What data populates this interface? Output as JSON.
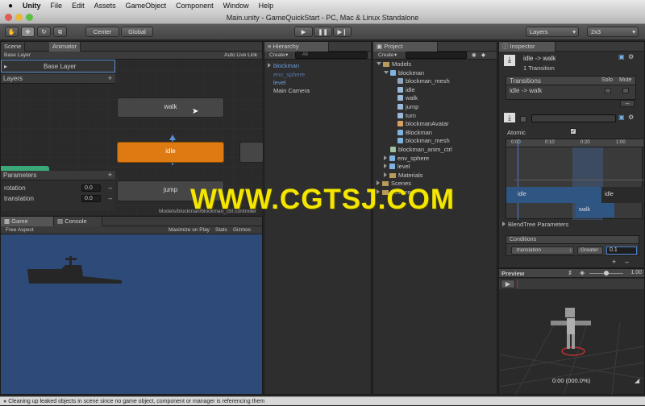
{
  "menubar": {
    "app": "Unity",
    "items": [
      "File",
      "Edit",
      "Assets",
      "GameObject",
      "Component",
      "Window",
      "Help"
    ]
  },
  "window": {
    "title": "Main.unity - GameQuickStart - PC, Mac & Linux Standalone"
  },
  "toolbar": {
    "center": "Center",
    "global": "Global",
    "layers": "Layers",
    "layout": "2x3"
  },
  "animator": {
    "tabs": [
      "Scene",
      "Animator"
    ],
    "base_layer_crumb": "Base Layer",
    "auto_live_link": "Auto Live Link",
    "layer_name": "Base Layer",
    "layers_label": "Layers",
    "add": "+",
    "parameters_label": "Parameters",
    "params": [
      {
        "name": "rotation",
        "value": "0.0"
      },
      {
        "name": "translation",
        "value": "0.0"
      }
    ],
    "nodes": {
      "walk": "walk",
      "idle": "idle",
      "jump": "jump"
    },
    "footer": "Models/blockman/blockman_ctrl.controller"
  },
  "game": {
    "tabs": [
      "Game",
      "Console"
    ],
    "aspect": "Free Aspect",
    "maximize": "Maximize on Play",
    "stats": "Stats",
    "gizmos": "Gizmos"
  },
  "hierarchy": {
    "tab": "Hierarchy",
    "create": "Create",
    "search": "All",
    "items": [
      {
        "label": "blockman",
        "color": "#6a9fe0"
      },
      {
        "label": "env_sphere",
        "color": "#5577aa"
      },
      {
        "label": "level",
        "color": "#6a9fe0"
      },
      {
        "label": "Main Camera",
        "color": "#c8c8c8"
      }
    ]
  },
  "project": {
    "tab": "Project",
    "create": "Create",
    "items": [
      {
        "label": "Models",
        "indent": 0,
        "kind": "folder",
        "exp": "open"
      },
      {
        "label": "blockman",
        "indent": 1,
        "kind": "model",
        "exp": "open"
      },
      {
        "label": "blockman_mesh",
        "indent": 2,
        "kind": "mesh",
        "exp": ""
      },
      {
        "label": "idle",
        "indent": 2,
        "kind": "anim",
        "exp": ""
      },
      {
        "label": "walk",
        "indent": 2,
        "kind": "anim",
        "exp": ""
      },
      {
        "label": "jump",
        "indent": 2,
        "kind": "anim",
        "exp": ""
      },
      {
        "label": "turn",
        "indent": 2,
        "kind": "anim",
        "exp": ""
      },
      {
        "label": "blockmanAvatar",
        "indent": 2,
        "kind": "avatar",
        "exp": ""
      },
      {
        "label": "Blockman",
        "indent": 2,
        "kind": "model",
        "exp": ""
      },
      {
        "label": "blockman_mesh",
        "indent": 2,
        "kind": "model",
        "exp": ""
      },
      {
        "label": "blockman_anim_ctrl",
        "indent": 1,
        "kind": "ctrl",
        "exp": ""
      },
      {
        "label": "env_sphere",
        "indent": 1,
        "kind": "model",
        "exp": "closed"
      },
      {
        "label": "level",
        "indent": 1,
        "kind": "model",
        "exp": "closed"
      },
      {
        "label": "Materials",
        "indent": 1,
        "kind": "folder",
        "exp": "closed"
      },
      {
        "label": "Scenes",
        "indent": 0,
        "kind": "folder",
        "exp": "closed"
      },
      {
        "label": "Textures",
        "indent": 0,
        "kind": "folder",
        "exp": "closed"
      }
    ]
  },
  "inspector": {
    "tab": "Inspector",
    "title": "idle -> walk",
    "subtitle": "1 Transition",
    "transitions_label": "Transitions",
    "solo": "Solo",
    "mute": "Mute",
    "transition_row": "idle -> walk",
    "atomic": "Atomic",
    "timeline_ticks": [
      "0:00",
      "0:10",
      "0:20",
      "1:00"
    ],
    "bar_idle": "idle",
    "bar_idle2": "idle",
    "bar_walk": "walk",
    "blendtree": "BlendTree Parameters",
    "conditions": "Conditions",
    "cond_param": "translation",
    "cond_op": "Greater",
    "cond_value": "0.1",
    "preview": "Preview",
    "preview_zoom": "1.00",
    "preview_time": "0:00 (000.0%)"
  },
  "watermark": "WWW.CGTSJ.COM",
  "status": "Cleaning up leaked objects in scene since no game object, component or manager is referencing them"
}
